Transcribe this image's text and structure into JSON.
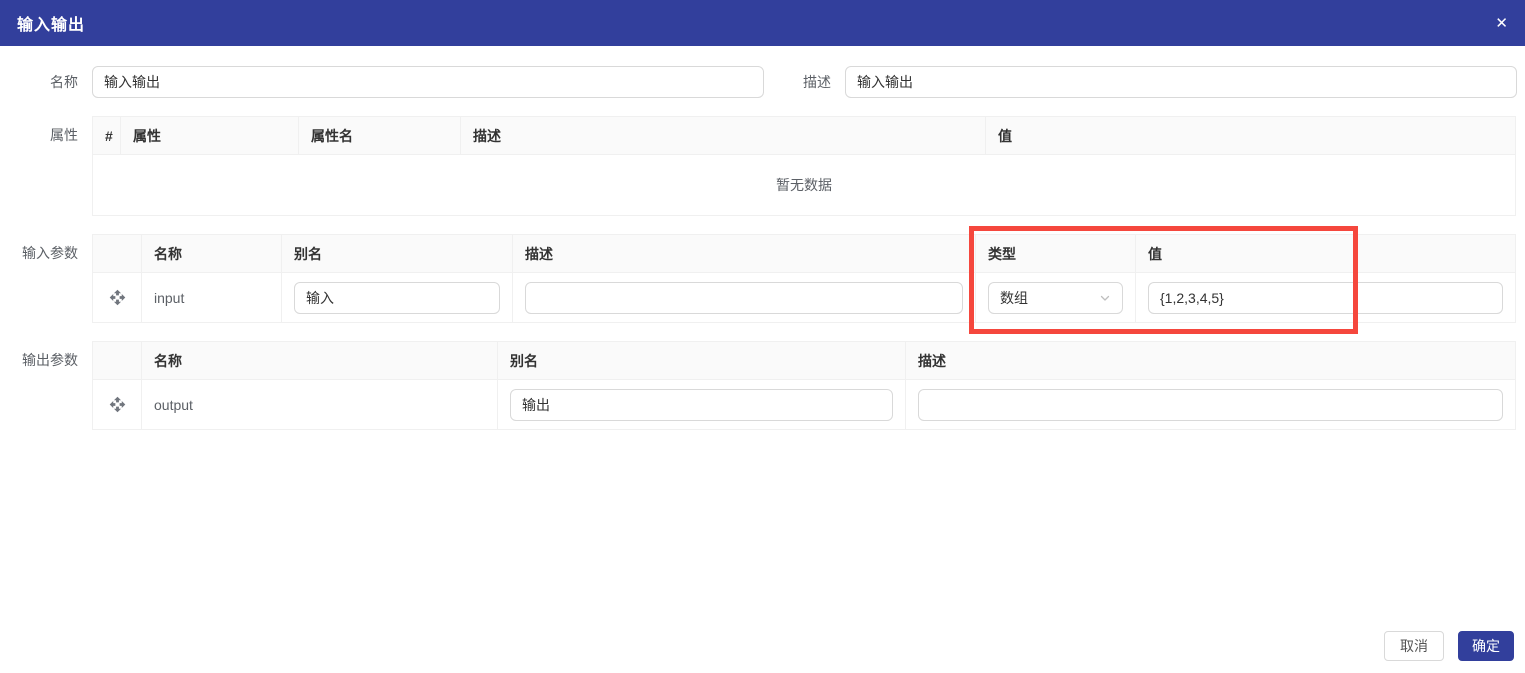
{
  "dialog": {
    "title": "输入输出",
    "close_icon_glyph": "✕"
  },
  "form": {
    "name_label": "名称",
    "name_value": "输入输出",
    "desc_label": "描述",
    "desc_value": "输入输出"
  },
  "attributes": {
    "section_label": "属性",
    "columns": [
      "#",
      "属性",
      "属性名",
      "描述",
      "值"
    ],
    "empty_text": "暂无数据"
  },
  "input_params": {
    "section_label": "输入参数",
    "columns": [
      "",
      "名称",
      "别名",
      "描述",
      "类型",
      "值"
    ],
    "rows": [
      {
        "name": "input",
        "alias": "输入",
        "description": "",
        "type": "数组",
        "value": "{1,2,3,4,5}"
      }
    ]
  },
  "output_params": {
    "section_label": "输出参数",
    "columns": [
      "",
      "名称",
      "别名",
      "描述"
    ],
    "rows": [
      {
        "name": "output",
        "alias": "输出",
        "description": ""
      }
    ]
  },
  "footer": {
    "cancel_label": "取消",
    "ok_label": "确定"
  },
  "icons": {
    "close": "close-icon",
    "drag": "move-cross-icon",
    "select": "chevron-down-icon"
  },
  "colors": {
    "header_bg": "#323f9c",
    "primary_button_bg": "#323f9c",
    "highlight_box": "#f5473d",
    "table_header_bg": "#fafafa",
    "table_border": "#f0f0f0",
    "input_border": "#d9d9d9"
  }
}
